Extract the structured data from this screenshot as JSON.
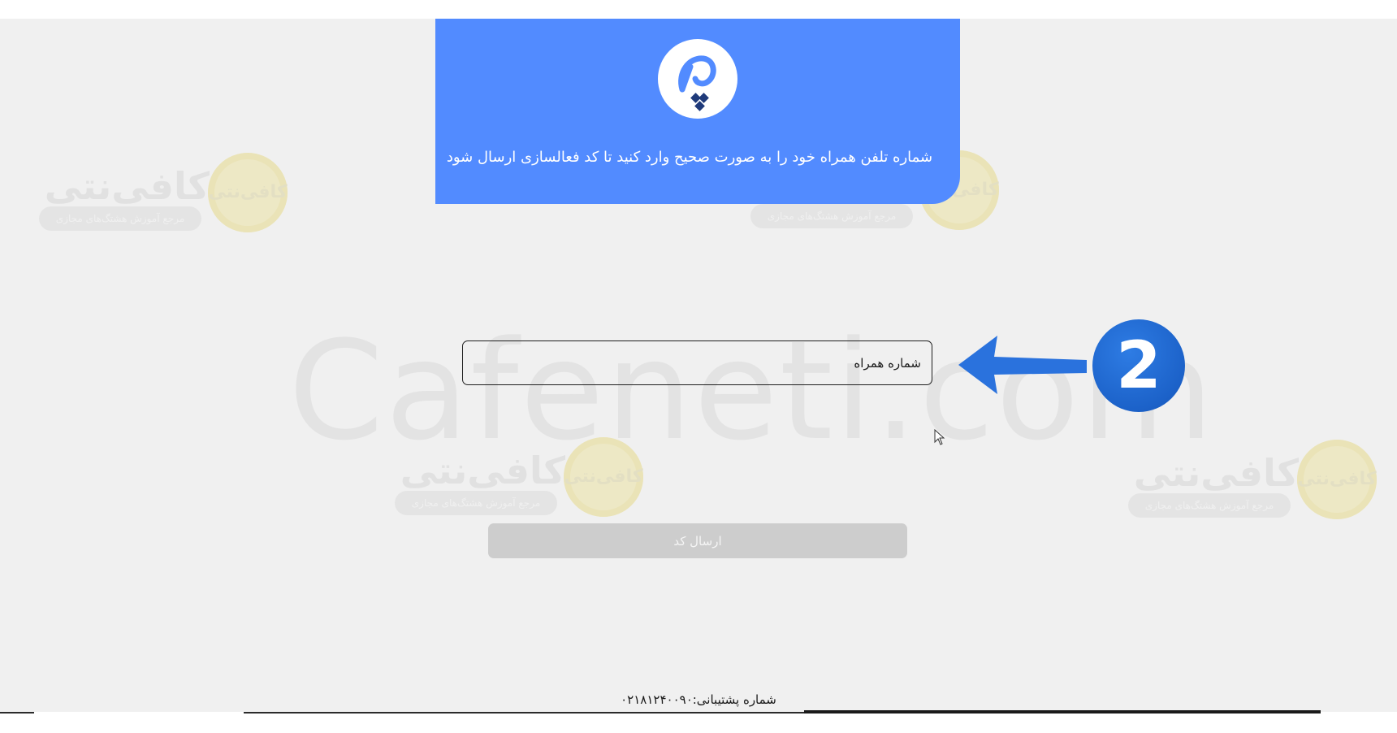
{
  "header": {
    "logo": "pashmak-logo",
    "instruction": "شماره تلفن همراه خود را به صورت صحیح وارد کنید تا کد فعالسازی ارسال شود"
  },
  "form": {
    "phone_placeholder": "شماره همراه",
    "submit_label": "ارسال کد"
  },
  "footer": {
    "support": "شماره پشتیبانی:۰۲۱۸۱۲۴۰۰۹۰"
  },
  "annotation": {
    "step_number": "2",
    "arrow_color": "#2a72dd"
  },
  "watermark": {
    "domain": "Cafeneti.com",
    "logo_word": "کافی‌نتی",
    "badge_word": "کافی‌نتی",
    "tagline": "مرجع آموزش هشتگ‌های مجازی"
  },
  "colors": {
    "header_bg": "#528bff",
    "page_bg": "#f0f0f0",
    "button_disabled": "#cdcdcd"
  }
}
